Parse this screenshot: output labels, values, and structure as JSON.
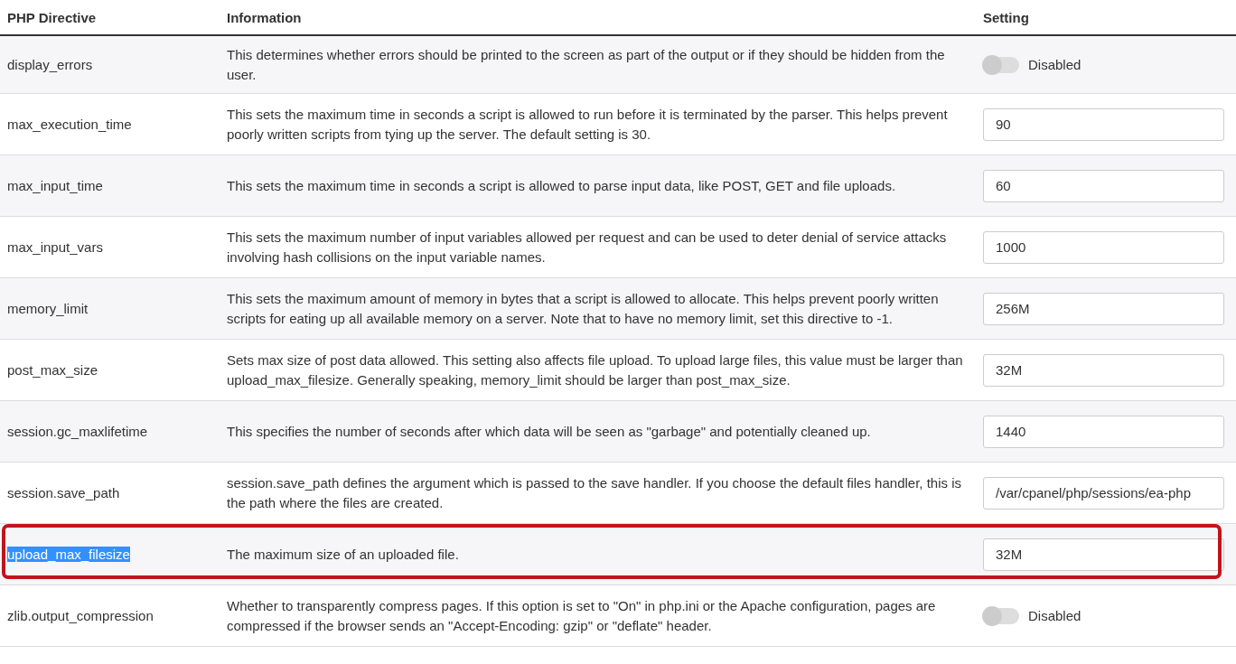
{
  "table": {
    "columns": [
      "PHP Directive",
      "Information",
      "Setting"
    ],
    "rows": [
      {
        "directive": "display_errors",
        "information": "This determines whether errors should be printed to the screen as part of the output or if they should be hidden from the user.",
        "setting": {
          "kind": "toggle",
          "on": false,
          "label": "Disabled"
        },
        "highlighted": false,
        "text_selected": false
      },
      {
        "directive": "max_execution_time",
        "information": "This sets the maximum time in seconds a script is allowed to run before it is terminated by the parser. This helps prevent poorly written scripts from tying up the server. The default setting is 30.",
        "setting": {
          "kind": "input",
          "value": "90"
        },
        "highlighted": false,
        "text_selected": false
      },
      {
        "directive": "max_input_time",
        "information": "This sets the maximum time in seconds a script is allowed to parse input data, like POST, GET and file uploads.",
        "setting": {
          "kind": "input",
          "value": "60"
        },
        "highlighted": false,
        "text_selected": false
      },
      {
        "directive": "max_input_vars",
        "information": "This sets the maximum number of input variables allowed per request and can be used to deter denial of service attacks involving hash collisions on the input variable names.",
        "setting": {
          "kind": "input",
          "value": "1000"
        },
        "highlighted": false,
        "text_selected": false
      },
      {
        "directive": "memory_limit",
        "information": "This sets the maximum amount of memory in bytes that a script is allowed to allocate. This helps prevent poorly written scripts for eating up all available memory on a server. Note that to have no memory limit, set this directive to -1.",
        "setting": {
          "kind": "input",
          "value": "256M"
        },
        "highlighted": false,
        "text_selected": false
      },
      {
        "directive": "post_max_size",
        "information": "Sets max size of post data allowed. This setting also affects file upload. To upload large files, this value must be larger than upload_max_filesize. Generally speaking, memory_limit should be larger than post_max_size.",
        "setting": {
          "kind": "input",
          "value": "32M"
        },
        "highlighted": false,
        "text_selected": false
      },
      {
        "directive": "session.gc_maxlifetime",
        "information": "This specifies the number of seconds after which data will be seen as \"garbage\" and potentially cleaned up.",
        "setting": {
          "kind": "input",
          "value": "1440"
        },
        "highlighted": false,
        "text_selected": false
      },
      {
        "directive": "session.save_path",
        "information": "session.save_path defines the argument which is passed to the save handler. If you choose the default files handler, this is the path where the files are created.",
        "setting": {
          "kind": "input",
          "value": "/var/cpanel/php/sessions/ea-php"
        },
        "highlighted": false,
        "text_selected": false
      },
      {
        "directive": "upload_max_filesize",
        "information": "The maximum size of an uploaded file.",
        "setting": {
          "kind": "input",
          "value": "32M"
        },
        "highlighted": true,
        "text_selected": true
      },
      {
        "directive": "zlib.output_compression",
        "information": "Whether to transparently compress pages. If this option is set to \"On\" in php.ini or the Apache configuration, pages are compressed if the browser sends an \"Accept-Encoding: gzip\" or \"deflate\" header.",
        "setting": {
          "kind": "toggle",
          "on": false,
          "label": "Disabled"
        },
        "highlighted": false,
        "text_selected": false
      }
    ]
  }
}
